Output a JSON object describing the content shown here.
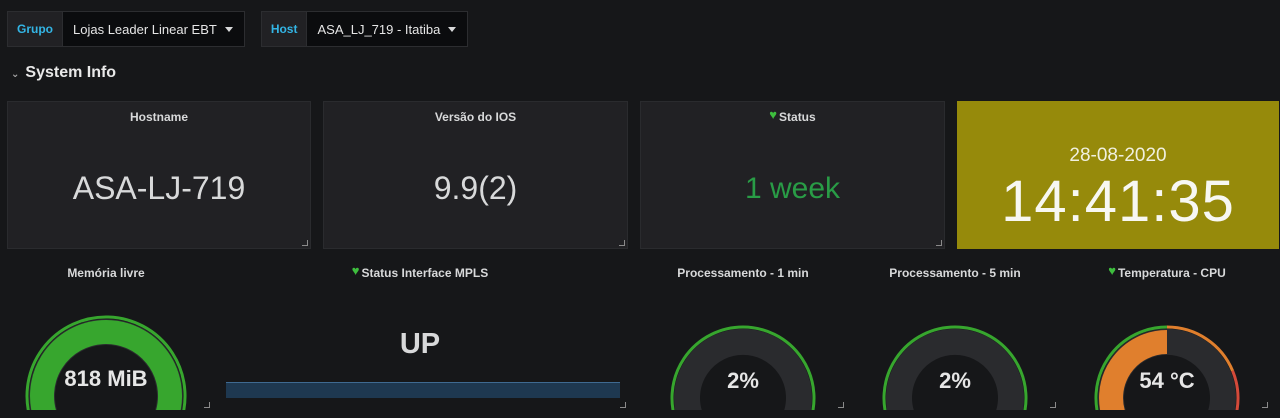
{
  "variables": [
    {
      "label": "Grupo",
      "value": "Lojas Leader Linear EBT"
    },
    {
      "label": "Host",
      "value": "ASA_LJ_719 - Itatiba"
    }
  ],
  "row": {
    "title": "System Info"
  },
  "panels": {
    "hostname": {
      "title": "Hostname",
      "value": "ASA-LJ-719"
    },
    "ios": {
      "title": "Versão do IOS",
      "value": "9.9(2)"
    },
    "status": {
      "title": "Status",
      "value": "1 week",
      "color": "#299c46"
    },
    "clock": {
      "date": "28-08-2020",
      "time": "14:41:35",
      "bg": "#968a0b"
    },
    "memoria": {
      "title": "Memória livre",
      "value": "818 MiB",
      "level": 0.97,
      "color": "#37a62e"
    },
    "mpls": {
      "title": "Status Interface MPLS",
      "value": "UP"
    },
    "proc1": {
      "title": "Processamento - 1 min",
      "value": "2%",
      "level": 0.02,
      "color": "#37a62e"
    },
    "proc5": {
      "title": "Processamento - 5 min",
      "value": "2%",
      "level": 0.02,
      "color": "#37a62e"
    },
    "temp": {
      "title": "Temperatura - CPU",
      "value": "54 °C",
      "level": 0.5,
      "color": "#e07f2d"
    }
  },
  "colors": {
    "ok": "#37a62e",
    "warn": "#e07f2d",
    "crit": "#d44a3a",
    "track": "#2a2b2e"
  }
}
